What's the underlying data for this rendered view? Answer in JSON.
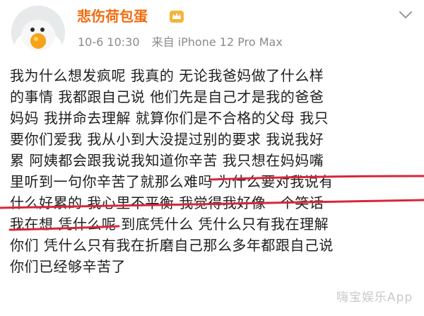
{
  "post": {
    "username": "悲伤荷包蛋",
    "timestamp": "10-6 10:30",
    "source": "来自 iPhone 12 Pro Max",
    "lines": [
      "我为什么想发疯呢 我真的 无论我爸妈做了什么样",
      "的事情 我都跟自己说 他们先是自己才是我的爸爸",
      "妈妈 我拼命去理解 就算你们是不合格的父母 我只",
      "要你们爱我 我从小到大没提过别的要求 我说我好",
      "累 阿姨都会跟我说我知道你辛苦 我只想在妈妈嘴",
      "里听到一句你辛苦了就那么难吗 为什么要对我说有",
      "什么好累的 我心里不平衡 我觉得我好像一个笑话",
      "我在想 凭什么呢 到底凭什么 凭什么只有我在理解",
      "你们 凭什么只有我在折磨自己那么多年都跟自己说",
      "你们已经够辛苦了"
    ]
  },
  "icons": {
    "avatar": "cartoon-egg-avatar",
    "badge": "crown-icon",
    "menu": "chevron-down-icon"
  },
  "watermark": "嗨宝娱乐App",
  "colors": {
    "username": "#f26b0f",
    "meta": "#8a8a8a",
    "underline": "#d8263a",
    "text": "#1f1f1f"
  }
}
